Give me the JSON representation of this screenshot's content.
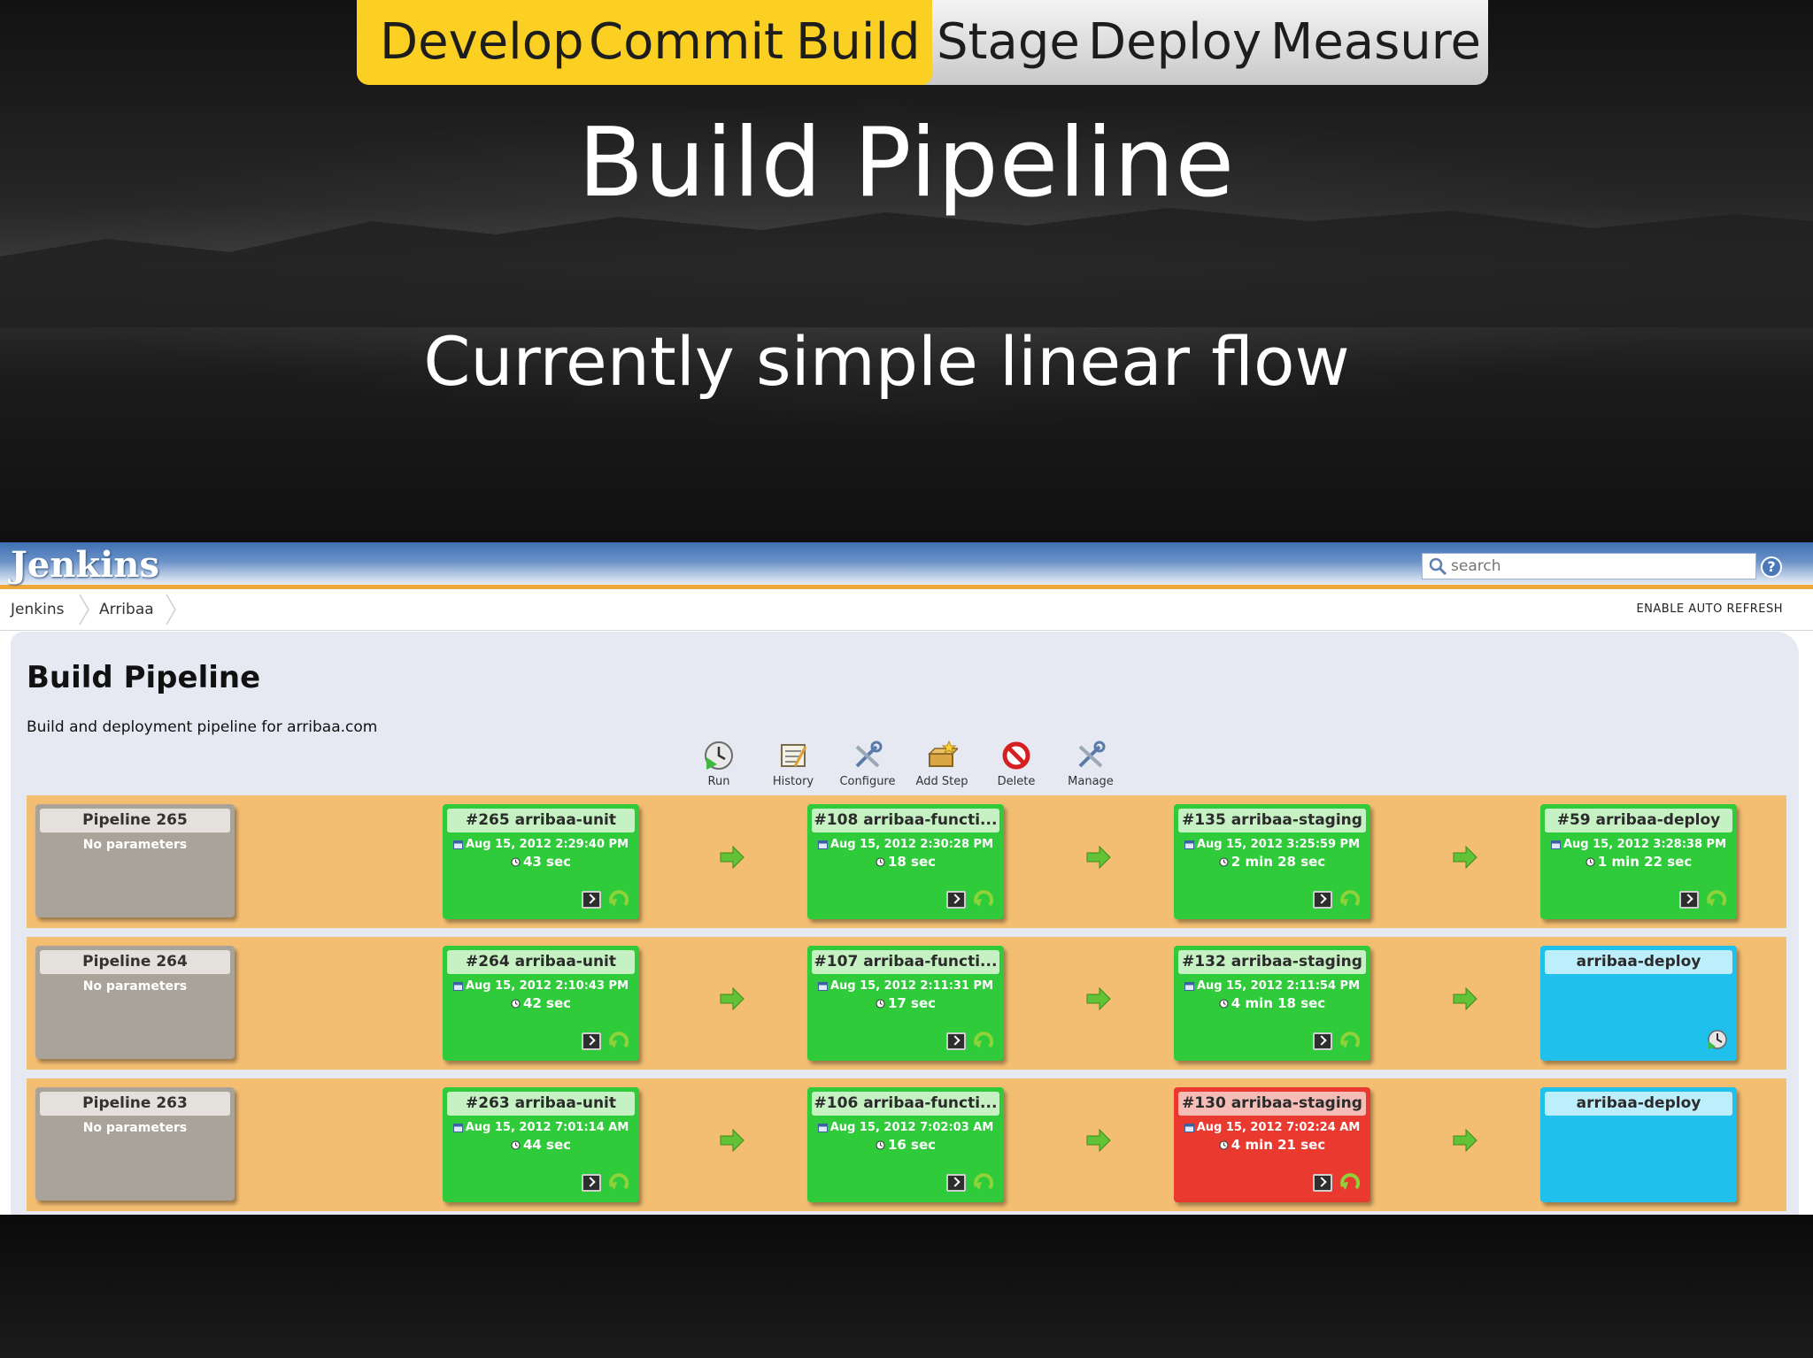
{
  "slide": {
    "stages": [
      "Develop",
      "Commit",
      "Build",
      "Stage",
      "Deploy",
      "Measure"
    ],
    "active_stages": [
      "Develop",
      "Commit",
      "Build"
    ],
    "title": "Build Pipeline",
    "subtitle": "Currently simple linear flow",
    "highlight_color": "#fcd022"
  },
  "jenkins": {
    "logo": "Jenkins",
    "search": {
      "placeholder": "search",
      "icon": "search-icon"
    },
    "help_icon": "?",
    "breadcrumb": [
      "Jenkins",
      "Arribaa"
    ],
    "auto_refresh": "ENABLE AUTO REFRESH",
    "page_title": "Build Pipeline",
    "description": "Build and deployment pipeline for arribaa.com",
    "toolbar": [
      {
        "label": "Run",
        "icon": "run-icon"
      },
      {
        "label": "History",
        "icon": "history-icon"
      },
      {
        "label": "Configure",
        "icon": "configure-icon"
      },
      {
        "label": "Add Step",
        "icon": "add-step-icon"
      },
      {
        "label": "Delete",
        "icon": "delete-icon"
      },
      {
        "label": "Manage",
        "icon": "manage-icon"
      }
    ],
    "colors": {
      "success": "#2fcb3a",
      "failed": "#ea3a30",
      "pending": "#1fc1ec",
      "row": "#f4be72",
      "pipeline_label": "#a9a39a"
    },
    "pipelines": [
      {
        "name": "Pipeline 265",
        "params": "No parameters",
        "jobs": [
          {
            "title": "#265 arribaa-unit",
            "date": "Aug 15, 2012 2:29:40 PM",
            "duration": "43 sec",
            "status": "success"
          },
          {
            "title": "#108 arribaa-functi...",
            "date": "Aug 15, 2012 2:30:28 PM",
            "duration": "18 sec",
            "status": "success"
          },
          {
            "title": "#135 arribaa-staging",
            "date": "Aug 15, 2012 3:25:59 PM",
            "duration": "2 min 28 sec",
            "status": "success"
          },
          {
            "title": "#59 arribaa-deploy",
            "date": "Aug 15, 2012 3:28:38 PM",
            "duration": "1 min 22 sec",
            "status": "success"
          }
        ]
      },
      {
        "name": "Pipeline 264",
        "params": "No parameters",
        "jobs": [
          {
            "title": "#264 arribaa-unit",
            "date": "Aug 15, 2012 2:10:43 PM",
            "duration": "42 sec",
            "status": "success"
          },
          {
            "title": "#107 arribaa-functi...",
            "date": "Aug 15, 2012 2:11:31 PM",
            "duration": "17 sec",
            "status": "success"
          },
          {
            "title": "#132 arribaa-staging",
            "date": "Aug 15, 2012 2:11:54 PM",
            "duration": "4 min 18 sec",
            "status": "success"
          },
          {
            "title": "arribaa-deploy",
            "date": "",
            "duration": "",
            "status": "pending"
          }
        ]
      },
      {
        "name": "Pipeline 263",
        "params": "No parameters",
        "jobs": [
          {
            "title": "#263 arribaa-unit",
            "date": "Aug 15, 2012 7:01:14 AM",
            "duration": "44 sec",
            "status": "success"
          },
          {
            "title": "#106 arribaa-functi...",
            "date": "Aug 15, 2012 7:02:03 AM",
            "duration": "16 sec",
            "status": "success"
          },
          {
            "title": "#130 arribaa-staging",
            "date": "Aug 15, 2012 7:02:24 AM",
            "duration": "4 min 21 sec",
            "status": "failed"
          },
          {
            "title": "arribaa-deploy",
            "date": "",
            "duration": "",
            "status": "pending"
          }
        ]
      }
    ]
  }
}
